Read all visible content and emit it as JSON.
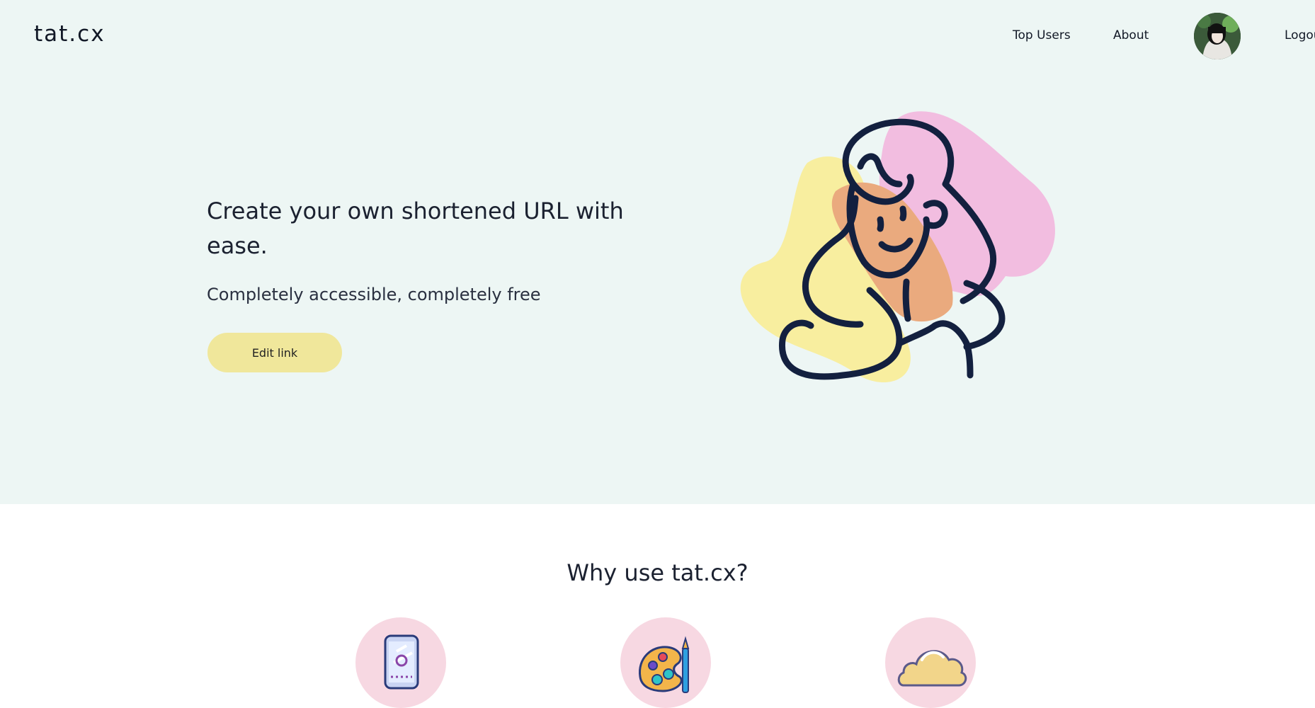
{
  "header": {
    "logo": "tat.cx",
    "nav": {
      "top_users": "Top Users",
      "about": "About",
      "logout": "Logout"
    }
  },
  "hero": {
    "headline": "Create your own shortened URL with ease.",
    "subline": "Completely accessible, completely free",
    "edit_button": "Edit link"
  },
  "features": {
    "title": "Why use tat.cx?",
    "icons": [
      "phone-icon",
      "palette-icon",
      "cloud-icon"
    ]
  },
  "colors": {
    "hero_bg": "#edf6f4",
    "button_bg": "#f0e79b",
    "feature_circle": "#f7d8e2",
    "illustration_pink": "#f2bde0",
    "illustration_yellow": "#f8ee9f",
    "illustration_skin": "#eaaa7e",
    "line_navy": "#13203f"
  }
}
